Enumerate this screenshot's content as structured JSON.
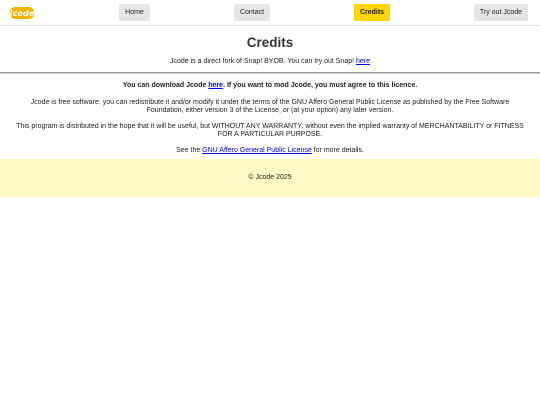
{
  "nav": {
    "logo_name": "jcode-logo",
    "home": "Home",
    "contact": "Contact",
    "credits": "Credits",
    "try": "Try out Jcode"
  },
  "header": {
    "title": "Credits",
    "subtitle_pre": "Jcode is a direct fork of Snap! BYOB. You can try out Snap! ",
    "subtitle_link": "here"
  },
  "content": {
    "download_pre": "You can download Jcode ",
    "download_link": "here",
    "download_post": ". If you want to mod Jcode, you must agree to this licence.",
    "para1": "Jcode is free software: you can redistribute it and/or modify it under the terms of the GNU Affero General Public License as published by the Free Software Foundation, either version 3 of the License, or (at your option) any later version.",
    "para2": "This program is distributed in the hope that it will be useful, but WITHOUT ANY WARRANTY; without even the implied warranty of MERCHANTABILITY or FITNESS FOR A PARTICULAR PURPOSE.",
    "para3_pre": "See the ",
    "para3_link": "GNU Affero General Public License",
    "para3_post": " for more details."
  },
  "footer": {
    "copyright": "© Jcode 2025"
  },
  "colors": {
    "accent": "#ffd600",
    "footer_bg": "#fff9c4",
    "link": "#0000ee"
  }
}
